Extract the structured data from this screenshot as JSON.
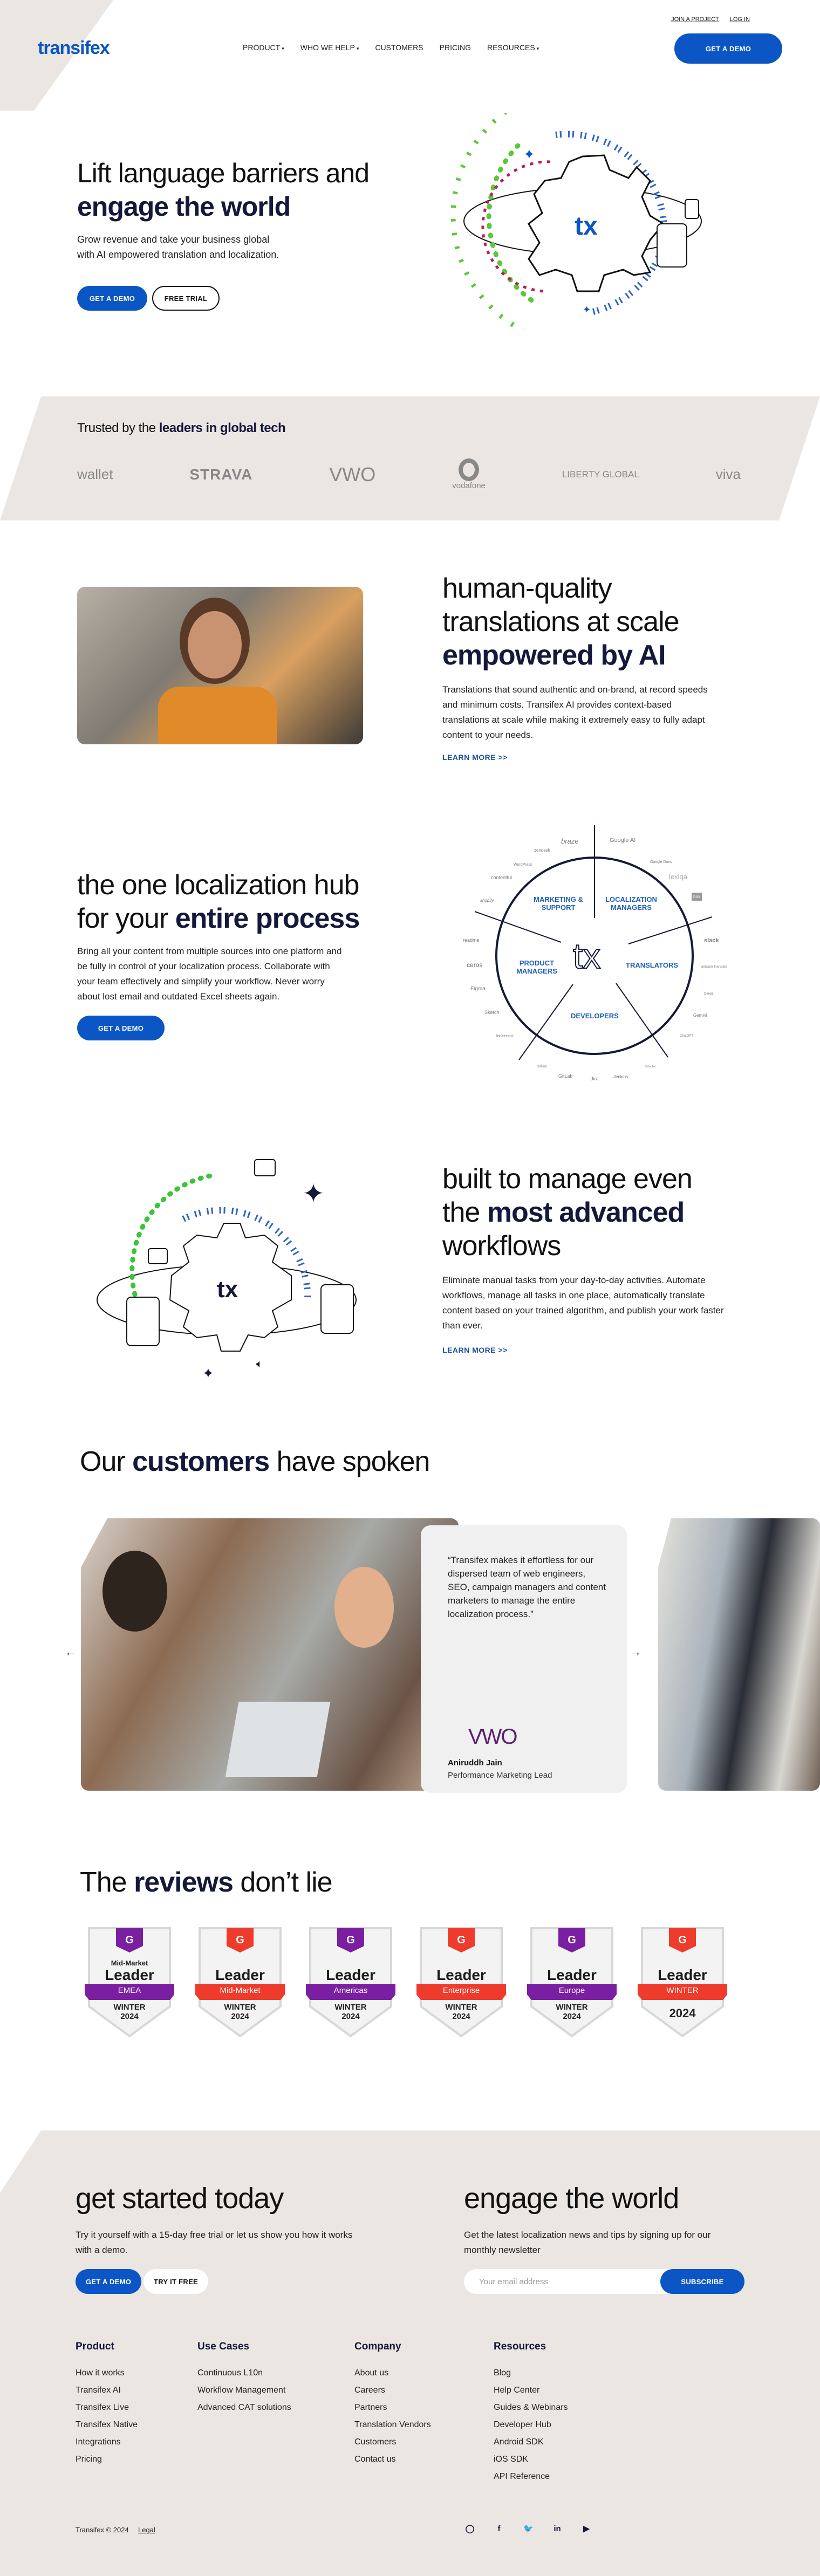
{
  "colors": {
    "brand_blue": "#0b56c4",
    "navy": "#14183a",
    "beige": "#ebe6e2",
    "g2_purple": "#7b1fa2",
    "g2_red": "#ef3b2c",
    "green": "#5ac83a"
  },
  "header": {
    "logo": "transifex",
    "top_links": [
      "JOIN A PROJECT",
      "LOG IN"
    ],
    "nav": [
      {
        "label": "PRODUCT",
        "dropdown": true
      },
      {
        "label": "WHO WE HELP",
        "dropdown": true
      },
      {
        "label": "CUSTOMERS",
        "dropdown": false
      },
      {
        "label": "PRICING",
        "dropdown": false
      },
      {
        "label": "RESOURCES",
        "dropdown": true
      }
    ],
    "cta": "GET A DEMO",
    "caret": "▾"
  },
  "hero": {
    "title_light": "Lift language barriers and",
    "title_bold": "engage the world",
    "subtitle_1": "Grow revenue and take your business global",
    "subtitle_2": "with AI empowered translation and localization.",
    "primary_button": "GET A DEMO",
    "secondary_button": "FREE TRIAL",
    "illustration_logo": "tx"
  },
  "trusted": {
    "title_light": "Trusted by the",
    "title_bold": "leaders in global tech",
    "logos": [
      "wallet",
      "STRAVA",
      "VWO",
      "vodafone",
      "LIBERTY GLOBAL",
      "viva"
    ]
  },
  "feature_ai": {
    "title_l1": "human-quality",
    "title_l2": "translations at scale",
    "title_bold": "empowered by AI",
    "body": "Translations that sound authentic and on-brand, at record speeds and minimum costs. Transifex AI provides context-based translations at scale while making it extremely easy to fully adapt content to your needs.",
    "link": "LEARN MORE >>"
  },
  "feature_hub": {
    "title_l1": "the one localization hub",
    "title_l2_light": "for your",
    "title_l2_bold": "entire process",
    "body": "Bring all your content from multiple sources into one platform and be fully in control of your localization process. Collaborate with your team effectively and simplify your workflow. Never worry about lost email and outdated Excel sheets again.",
    "button": "GET A DEMO",
    "diagram": {
      "center": "tx",
      "segments": [
        "MARKETING & SUPPORT",
        "LOCALIZATION MANAGERS",
        "TRANSLATORS",
        "DEVELOPERS",
        "PRODUCT MANAGERS"
      ],
      "integrations": [
        "braze",
        "Google AI",
        "zendesk",
        "Google Docs",
        "WordPress",
        "lexiqa",
        "contentful",
        "box",
        "shopify",
        "slack",
        "readme",
        "amazon Translate",
        "ceros",
        "DeepL",
        "Figma",
        "Gemini",
        "Sketch",
        "ChatGPT",
        "BigCommerce",
        "Bitbucket",
        "GitHub",
        "GitLab",
        "Jira",
        "Jenkins"
      ]
    }
  },
  "feature_workflow": {
    "title_l1": "built to manage even",
    "title_l2_light": "the",
    "title_l2_bold": "most advanced",
    "title_l3": "workflows",
    "body": "Eliminate manual tasks from your day-to-day activities. Automate workflows, manage all tasks in one place, automatically translate content based on your trained algorithm, and publish your work faster than ever.",
    "link": "LEARN MORE >>"
  },
  "customers": {
    "title_light_1": "Our",
    "title_bold": "customers",
    "title_light_2": "have spoken",
    "quote": "“Transifex makes it effortless for our dispersed team of web engineers, SEO, campaign managers and content marketers to manage the entire localization process.”",
    "company": "VWO",
    "name": "Aniruddh Jain",
    "role": "Performance Marketing Lead",
    "prev_arrow": "←",
    "next_arrow": "→"
  },
  "reviews": {
    "title_light_1": "The",
    "title_bold": "reviews",
    "title_light_2": "don’t lie",
    "badges": [
      {
        "top": "Mid-Market",
        "title": "Leader",
        "ribbon": "EMEA",
        "season": "WINTER",
        "year": "2024",
        "color": "#7b1fa2"
      },
      {
        "top": "",
        "title": "Leader",
        "ribbon": "Mid-Market",
        "season": "WINTER",
        "year": "2024",
        "color": "#ef3b2c"
      },
      {
        "top": "",
        "title": "Leader",
        "ribbon": "Americas",
        "season": "WINTER",
        "year": "2024",
        "color": "#7b1fa2"
      },
      {
        "top": "",
        "title": "Leader",
        "ribbon": "Enterprise",
        "season": "WINTER",
        "year": "2024",
        "color": "#ef3b2c"
      },
      {
        "top": "",
        "title": "Leader",
        "ribbon": "Europe",
        "season": "WINTER",
        "year": "2024",
        "color": "#7b1fa2"
      },
      {
        "top": "",
        "title": "Leader",
        "ribbon": "WINTER",
        "season": "",
        "year": "2024",
        "color": "#ef3b2c"
      }
    ]
  },
  "get_started": {
    "title": "get started today",
    "body": "Try it yourself with a 15-day free trial or let us show you how it works with a demo.",
    "primary_button": "GET A DEMO",
    "secondary_button": "TRY IT FREE"
  },
  "newsletter": {
    "title": "engage the world",
    "body": "Get the latest localization news and tips by signing up for our monthly newsletter",
    "email_placeholder": "Your email address",
    "email_value": "",
    "button": "SUBSCRIBE"
  },
  "footer": {
    "columns": [
      {
        "title": "Product",
        "links": [
          "How it works",
          "Transifex AI",
          "Transifex Live",
          "Transifex Native",
          "Integrations",
          "Pricing"
        ]
      },
      {
        "title": "Use Cases",
        "links": [
          "Continuous L10n",
          "Workflow Management",
          "Advanced CAT solutions"
        ]
      },
      {
        "title": "Company",
        "links": [
          "About us",
          "Careers",
          "Partners",
          "Translation Vendors",
          "Customers",
          "Contact us"
        ]
      },
      {
        "title": "Resources",
        "links": [
          "Blog",
          "Help Center",
          "Guides & Webinars",
          "Developer Hub",
          "Android SDK",
          "iOS SDK",
          "API Reference"
        ]
      }
    ],
    "copyright": "Transifex © 2024",
    "legal": "Legal",
    "social": [
      {
        "name": "github-icon",
        "glyph": "◯"
      },
      {
        "name": "facebook-icon",
        "glyph": "f"
      },
      {
        "name": "twitter-icon",
        "glyph": "🐦"
      },
      {
        "name": "linkedin-icon",
        "glyph": "in"
      },
      {
        "name": "youtube-icon",
        "glyph": "▶"
      }
    ]
  }
}
